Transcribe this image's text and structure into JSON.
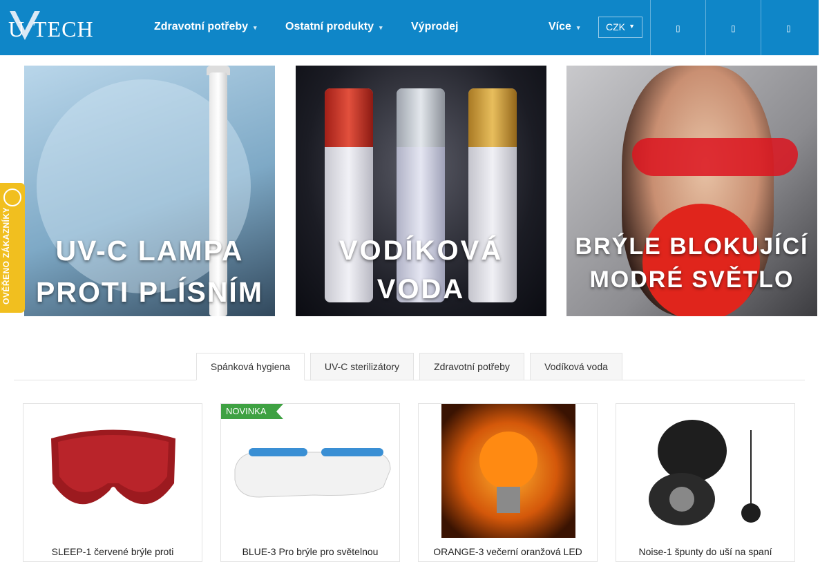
{
  "brand": {
    "logo_text": "TECH",
    "logo_letter": "U"
  },
  "nav": {
    "items": [
      {
        "label": "Zdravotní potřeby",
        "has_dropdown": true
      },
      {
        "label": "Ostatní produkty",
        "has_dropdown": true
      },
      {
        "label": "Výprodej",
        "has_dropdown": false
      },
      {
        "label": "Více",
        "has_dropdown": true
      }
    ],
    "currency": "CZK"
  },
  "header_icons": [
    "search-icon",
    "user-icon",
    "cart-icon"
  ],
  "banners": [
    {
      "title_line1": "UV-C LAMPA",
      "title_line2": "PROTI PLÍSNÍM"
    },
    {
      "title_line1": "VODÍKOVÁ",
      "title_line2": "VODA"
    },
    {
      "title_line1": "BRÝLE BLOKUJÍCÍ",
      "title_line2": "MODRÉ SVĚTLO"
    }
  ],
  "side_badge": {
    "label": "OVĚŘENO ZÁKAZNÍKY"
  },
  "tabs": [
    {
      "label": "Spánková hygiena",
      "active": true
    },
    {
      "label": "UV-C sterilizátory",
      "active": false
    },
    {
      "label": "Zdravotní potřeby",
      "active": false
    },
    {
      "label": "Vodíková voda",
      "active": false
    }
  ],
  "products": [
    {
      "title": "SLEEP-1 červené brýle proti",
      "badge": ""
    },
    {
      "title": "BLUE-3 Pro brýle pro světelnou",
      "badge": "NOVINKA"
    },
    {
      "title": "ORANGE-3 večerní oranžová LED",
      "badge": ""
    },
    {
      "title": "Noise-1 špunty do uší na spaní",
      "badge": ""
    }
  ],
  "colors": {
    "header": "#0f86c8",
    "badge": "#f1bf1f",
    "ribbon": "#3ea142"
  }
}
